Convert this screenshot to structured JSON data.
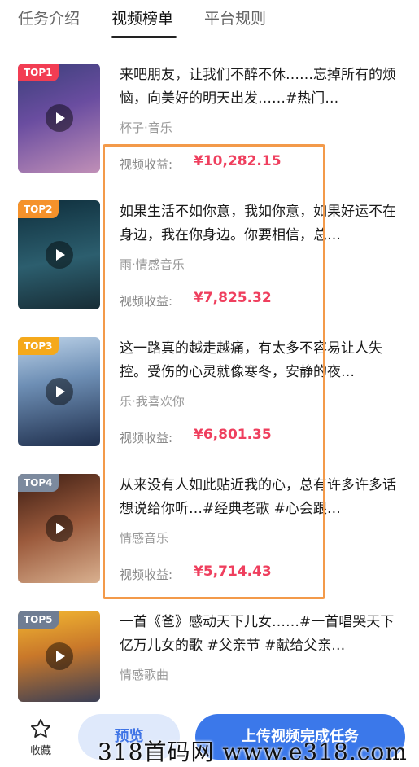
{
  "tabs": [
    {
      "label": "任务介绍"
    },
    {
      "label": "视频榜单"
    },
    {
      "label": "平台规则"
    }
  ],
  "earnings_label": "视频收益:",
  "items": [
    {
      "rank": "TOP1",
      "title": "来吧朋友，让我们不醉不休……忘掉所有的烦恼，向美好的明天出发……#热门…",
      "author": "杯子·音乐",
      "earnings": "¥10,282.15"
    },
    {
      "rank": "TOP2",
      "title": "如果生活不如你意，我如你意，如果好运不在身边，我在你身边。你要相信，总…",
      "author": "雨·情感音乐",
      "earnings": "¥7,825.32"
    },
    {
      "rank": "TOP3",
      "title": "这一路真的越走越痛，有太多不容易让人失控。受伤的心灵就像寒冬，安静的夜…",
      "author": "乐·我喜欢你",
      "earnings": "¥6,801.35"
    },
    {
      "rank": "TOP4",
      "title": "从来没有人如此贴近我的心，总有许多许多话想说给你听…#经典老歌 #心会跟…",
      "author": "情感音乐",
      "earnings": "¥5,714.43"
    },
    {
      "rank": "TOP5",
      "title": "一首《爸》感动天下儿女……#一首唱哭天下亿万儿女的歌 #父亲节 #献给父亲…",
      "author": "情感歌曲"
    }
  ],
  "bottom": {
    "favorite_label": "收藏",
    "preview_label": "预览",
    "upload_label": "上传视频完成任务"
  },
  "watermark": "318首码网 www.e318.com",
  "colors": {
    "accent": "#3b78ea",
    "price": "#ef3f5e",
    "highlight": "#f39a4a"
  },
  "icons": {
    "favorite": "star-outline-icon",
    "play": "play-icon"
  }
}
